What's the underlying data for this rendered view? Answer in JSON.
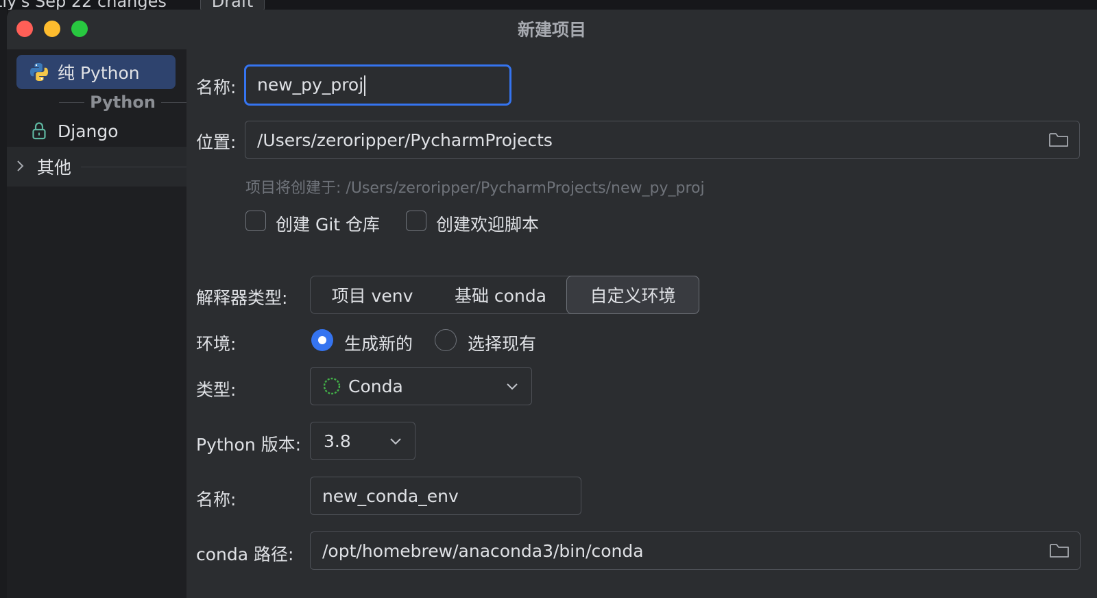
{
  "background": {
    "left_text": "tly's Sep 22 changes",
    "tab_label": "Draft"
  },
  "window": {
    "title": "新建项目"
  },
  "sidebar": {
    "items": [
      {
        "label": "纯 Python",
        "icon": "python-logo-icon",
        "selected": true
      },
      {
        "label": "Django",
        "icon": "lock-icon",
        "selected": false
      }
    ],
    "group_label": "Python",
    "other_label": "其他"
  },
  "form": {
    "name_label": "名称:",
    "name_value": "new_py_proj",
    "location_label": "位置:",
    "location_value": "/Users/zeroripper/PycharmProjects",
    "create_hint": "项目将创建于: /Users/zeroripper/PycharmProjects/new_py_proj",
    "git_checkbox_label": "创建 Git 仓库",
    "git_checked": false,
    "welcome_checkbox_label": "创建欢迎脚本",
    "welcome_checked": false,
    "interpreter_label": "解释器类型:",
    "interpreter_options": [
      "项目 venv",
      "基础 conda",
      "自定义环境"
    ],
    "interpreter_selected": "自定义环境",
    "env_label": "环境:",
    "env_options": [
      "生成新的",
      "选择现有"
    ],
    "env_selected": "生成新的",
    "type_label": "类型:",
    "type_value": "Conda",
    "python_version_label": "Python 版本:",
    "python_version_value": "3.8",
    "env_name_label": "名称:",
    "env_name_value": "new_conda_env",
    "conda_path_label": "conda 路径:",
    "conda_path_value": "/opt/homebrew/anaconda3/bin/conda"
  },
  "colors": {
    "accent": "#3574f0",
    "selected_bg": "#2e436e",
    "window_bg": "#2b2d30",
    "sidebar_bg": "#1e1f22",
    "close": "#ff5f57",
    "minimize": "#febc2e",
    "maximize": "#28c840"
  }
}
